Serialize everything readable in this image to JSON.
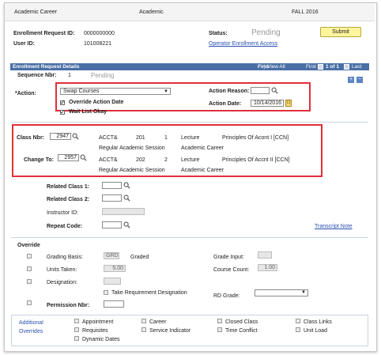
{
  "header": {
    "career_label": "Academic Career",
    "career_value": "Academic",
    "term": "FALL 2016"
  },
  "request": {
    "id_label": "Enrollment Request ID:",
    "id_value": "0000000000",
    "user_label": "User ID:",
    "user_value": "101008221",
    "status_label": "Status:",
    "status_value": "Pending",
    "submit_label": "Submit",
    "operator_link": "Operator Enrollment Access"
  },
  "details": {
    "title": "Enrollment Request Details",
    "find": "Find",
    "view_all": "View All",
    "first": "First",
    "counter": "1 of 1",
    "last": "Last",
    "seq_label": "Sequence Nbr:",
    "seq_value": "1",
    "seq_status": "Pending",
    "action_label": "*Action:",
    "action_value": "Swap Courses",
    "override_action_date": "Override Action Date",
    "wait_list": "Wait List Okay",
    "action_reason_label": "Action Reason:",
    "action_date_label": "Action Date:",
    "action_date_value": "10/14/2016"
  },
  "classes": {
    "class_nbr_label": "Class Nbr:",
    "class_nbr_value": "2947",
    "change_to_label": "Change To:",
    "change_to_value": "2957",
    "rows": [
      {
        "subject": "ACCT&",
        "catalog": "201",
        "section": "1",
        "component": "Lecture",
        "title": "Principles Of Acont I  [CCN]",
        "session": "Regular Academic Session",
        "career": "Academic Career"
      },
      {
        "subject": "ACCT&",
        "catalog": "202",
        "section": "2",
        "component": "Lecture",
        "title": "Principles Of Accnt II  [CCN]",
        "session": "Regular Academic Session",
        "career": "Academic Career"
      }
    ]
  },
  "related": {
    "related1": "Related Class 1:",
    "related2": "Related Class 2:",
    "instructor": "Instructor ID:",
    "repeat": "Repeat Code:",
    "transcript_link": "Transcript Note"
  },
  "override": {
    "title": "Override",
    "grading_basis_label": "Grading Basis:",
    "grading_basis_value": "GRD",
    "grading_basis_desc": "Graded",
    "units_label": "Units Taken:",
    "units_value": "5.00",
    "designation_label": "Designation:",
    "take_req": "Take Requirement Designation",
    "permission_label": "Permission Nbr:",
    "grade_input_label": "Grade Input:",
    "course_count_label": "Course Count:",
    "course_count_value": "1.00",
    "rd_grade_label": "RD Grade:"
  },
  "additional": {
    "title_line1": "Additional",
    "title_line2": "Overrides",
    "items": [
      "Appointment",
      "Career",
      "Closed Class",
      "Class Links",
      "Requisites",
      "Service Indicator",
      "Time Conflict",
      "Unit Load",
      "Dynamic Dates"
    ]
  }
}
